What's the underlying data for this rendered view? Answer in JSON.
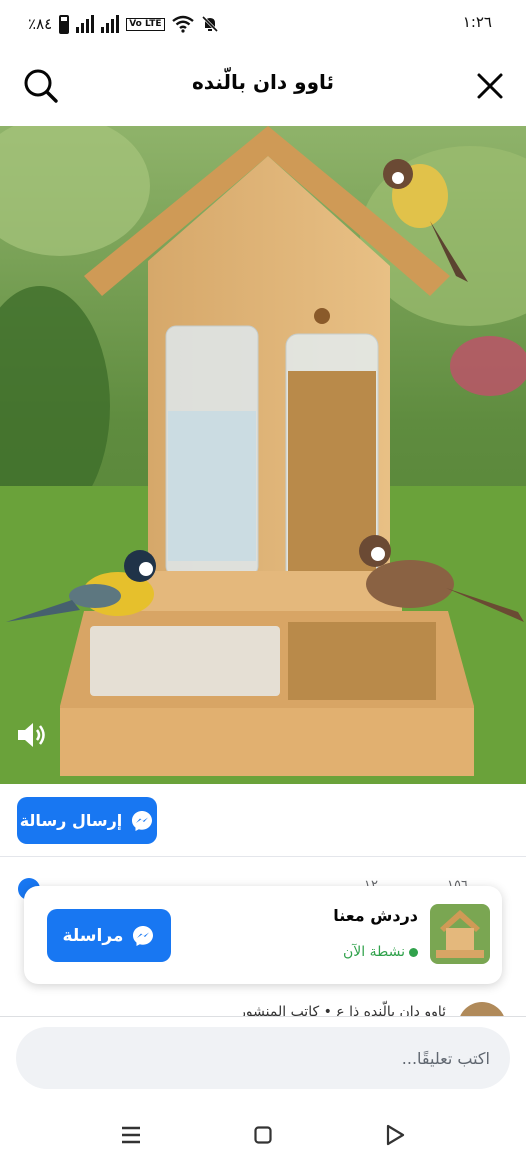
{
  "status_bar": {
    "battery_text": "٪٨٤",
    "volte": "Vo LTE",
    "time": "١:٢٦"
  },
  "header": {
    "title": "ئاوو دان بالّنده",
    "search_icon": "search-icon",
    "close_icon": "close-icon"
  },
  "media": {
    "description_icon": "speaker-icon"
  },
  "send_message": {
    "label": "إرسال رسالة",
    "icon": "messenger-icon"
  },
  "stats": {
    "likes_count": "١٥٦",
    "comments_count": "١٢"
  },
  "chat_card": {
    "title": "دردش معنا",
    "status": "نشطة الآن",
    "button_label": "مراسلة",
    "button_icon": "messenger-icon"
  },
  "comment_preview": {
    "text": "ئاوو دان بالّنده ذا ع • كاتب المنشور"
  },
  "comment_input": {
    "placeholder": "اكتب تعليقًا..."
  },
  "colors": {
    "accent": "#1877f2",
    "online": "#31a24c"
  },
  "nav": {
    "recents_icon": "menu-icon",
    "home_icon": "home-square-icon",
    "back_icon": "back-triangle-icon"
  }
}
